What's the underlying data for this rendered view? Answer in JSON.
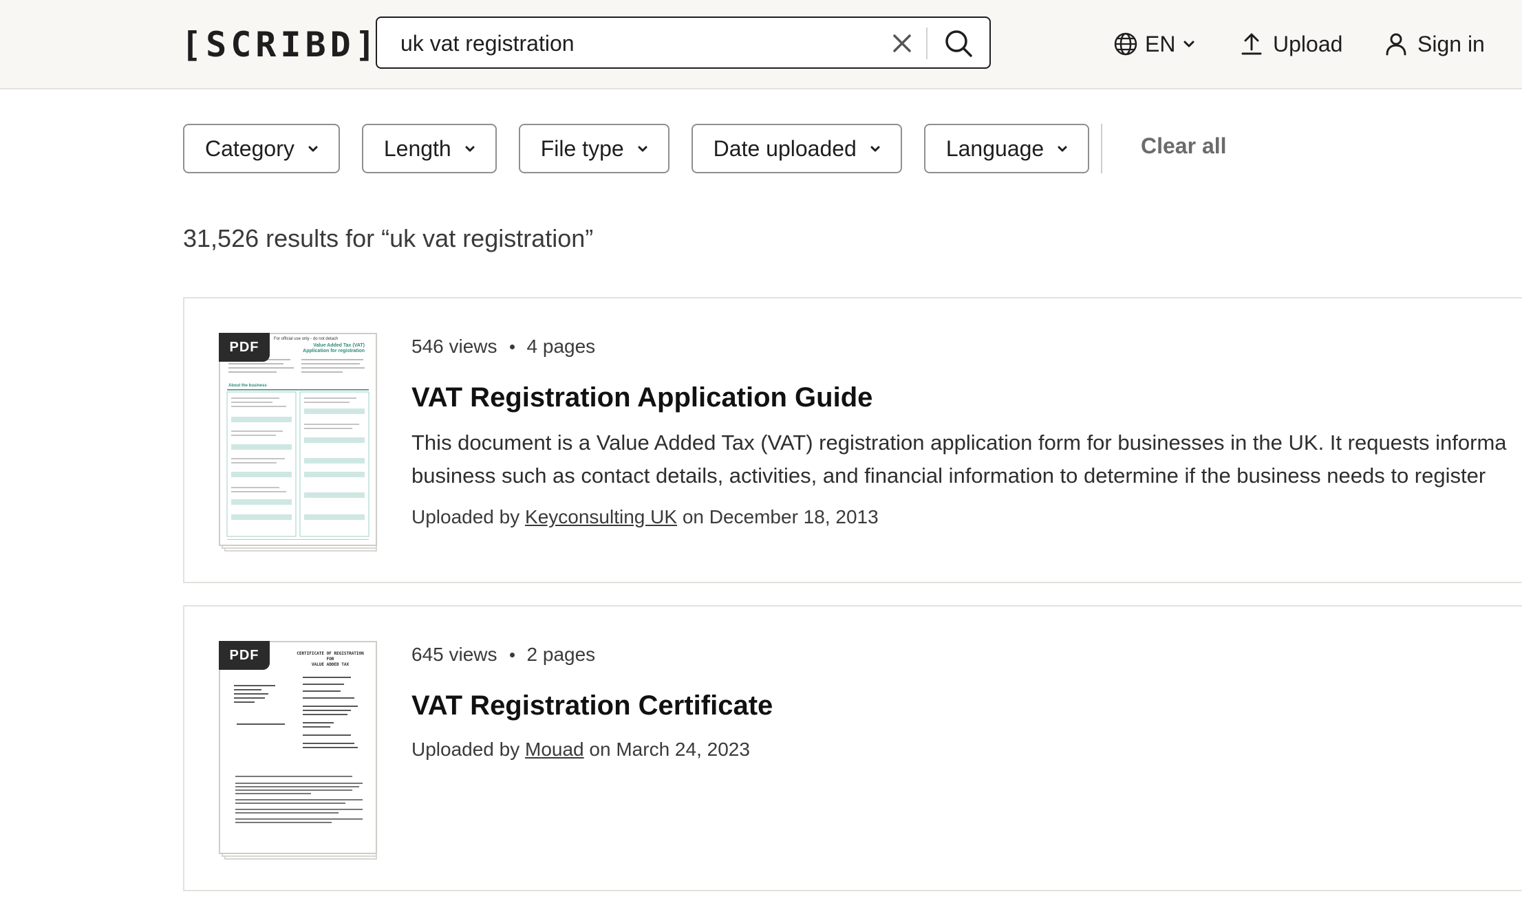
{
  "header": {
    "logo": "[SCRIBD]",
    "search_value": "uk vat registration",
    "language_label": "EN",
    "upload_label": "Upload",
    "signin_label": "Sign in"
  },
  "filters": {
    "items": [
      {
        "label": "Category"
      },
      {
        "label": "Length"
      },
      {
        "label": "File type"
      },
      {
        "label": "Date uploaded"
      },
      {
        "label": "Language"
      }
    ],
    "clear_all": "Clear all"
  },
  "results": {
    "count_text": "31,526 results for “uk vat registration”",
    "items": [
      {
        "badge": "PDF",
        "views": "546 views",
        "pages": "4 pages",
        "title": "VAT Registration Application Guide",
        "description_line1": "This document is a Value Added Tax (VAT) registration application form for businesses in the UK. It requests informa",
        "description_line2": "business such as contact details, activities, and financial information to determine if the business needs to register",
        "uploaded_prefix": "Uploaded by",
        "uploader": "Keyconsulting UK",
        "uploaded_suffix": "on December 18, 2013",
        "thumb_lines": [
          "For official use only - do not detach",
          "Value Added Tax (VAT)",
          "Application for registration",
          "About the business"
        ]
      },
      {
        "badge": "PDF",
        "views": "645 views",
        "pages": "2 pages",
        "title": "VAT Registration Certificate",
        "uploaded_prefix": "Uploaded by",
        "uploader": "Mouad",
        "uploaded_suffix": "on March 24, 2023",
        "thumb_lines": [
          "CERTIFICATE OF REGISTRATION",
          "FOR",
          "VALUE ADDED TAX"
        ]
      }
    ]
  },
  "colors": {
    "header_bg": "#f8f7f4",
    "text": "#1e1e1e",
    "badge_bg": "#2b2b2b",
    "thumb_accent": "#2e8b7a"
  }
}
